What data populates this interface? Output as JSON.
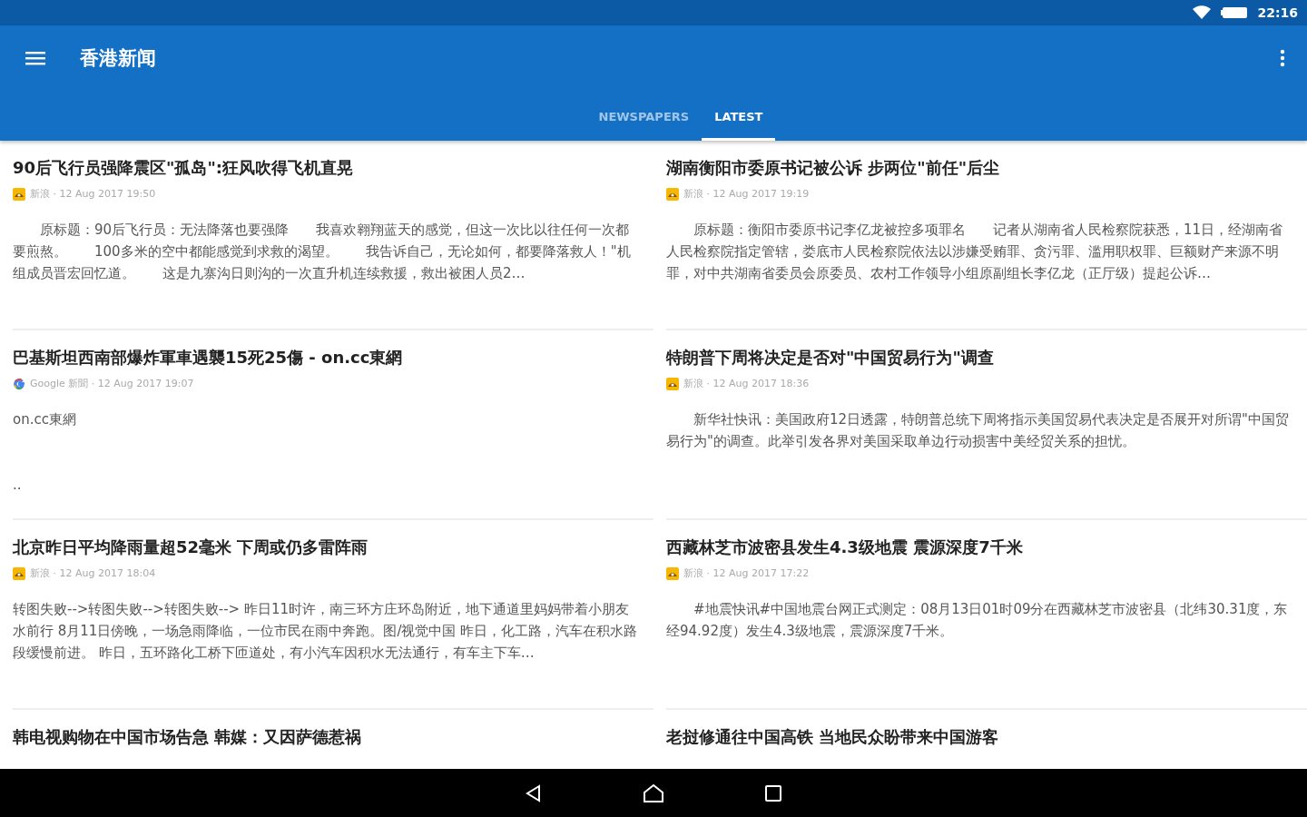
{
  "status_bar": {
    "time": "22:16"
  },
  "app_bar": {
    "title": "香港新闻"
  },
  "tabs": [
    {
      "label": "NEWSPAPERS",
      "selected": false
    },
    {
      "label": "LATEST",
      "selected": true
    }
  ],
  "articles": [
    {
      "title": "90后飞行员强降震区\"孤岛\":狂风吹得飞机直晃",
      "kind": "sina",
      "meta": "新浪 · 12 Aug 2017 19:50",
      "indented": true,
      "body": "原标题：90后飞行员：无法降落也要强降　　我喜欢翱翔蓝天的感觉，但这一次比以往任何一次都要煎熬。　　100多米的空中都能感觉到求救的渴望。　　我告诉自己，无论如何，都要降落救人！\"机组成员晋宏回忆道。　　这是九寨沟日则沟的一次直升机连续救援，救出被困人员2…"
    },
    {
      "title": "湖南衡阳市委原书记被公诉 步两位\"前任\"后尘",
      "kind": "sina",
      "meta": "新浪 · 12 Aug 2017 19:19",
      "indented": true,
      "body": "原标题：衡阳市委原书记李亿龙被控多项罪名　　记者从湖南省人民检察院获悉，11日，经湖南省人民检察院指定管辖，娄底市人民检察院依法以涉嫌受贿罪、贪污罪、滥用职权罪、巨额财产来源不明罪，对中共湖南省委员会原委员、农村工作领导小组原副组长李亿龙（正厅级）提起公诉…"
    },
    {
      "title": "巴基斯坦西南部爆炸軍車遇襲15死25傷 - on.cc東網",
      "kind": "google",
      "meta": "Google 新聞 · 12 Aug 2017 19:07",
      "indented": false,
      "body": "on.cc東網\n\n\n.."
    },
    {
      "title": "特朗普下周将决定是否对\"中国贸易行为\"调查",
      "kind": "sina",
      "meta": "新浪 · 12 Aug 2017 18:36",
      "indented": true,
      "body": "新华社快讯：美国政府12日透露，特朗普总统下周将指示美国贸易代表决定是否展开对所谓\"中国贸易行为\"的调查。此举引发各界对美国采取单边行动损害中美经贸关系的担忧。"
    },
    {
      "title": "北京昨日平均降雨量超52毫米 下周或仍多雷阵雨",
      "kind": "sina",
      "meta": "新浪 · 12 Aug 2017 18:04",
      "indented": false,
      "body": "转图失败-->转图失败-->转图失败--> 昨日11时许，南三环方庄环岛附近，地下通道里妈妈带着小朋友水前行 8月11日傍晚，一场急雨降临，一位市民在雨中奔跑。图/视觉中国 昨日，化工路，汽车在积水路段缓慢前进。 昨日，五环路化工桥下匝道处，有小汽车因积水无法通行，有车主下车…"
    },
    {
      "title": "西藏林芝市波密县发生4.3级地震 震源深度7千米",
      "kind": "sina",
      "meta": "新浪 · 12 Aug 2017 17:22",
      "indented": true,
      "body": "#地震快讯#中国地震台网正式测定：08月13日01时09分在西藏林芝市波密县（北纬30.31度，东经94.92度）发生4.3级地震，震源深度7千米。"
    },
    {
      "title": "韩电视购物在中国市场告急 韩媒：又因萨德惹祸"
    },
    {
      "title": "老挝修通往中国高铁 当地民众盼带来中国游客"
    }
  ]
}
